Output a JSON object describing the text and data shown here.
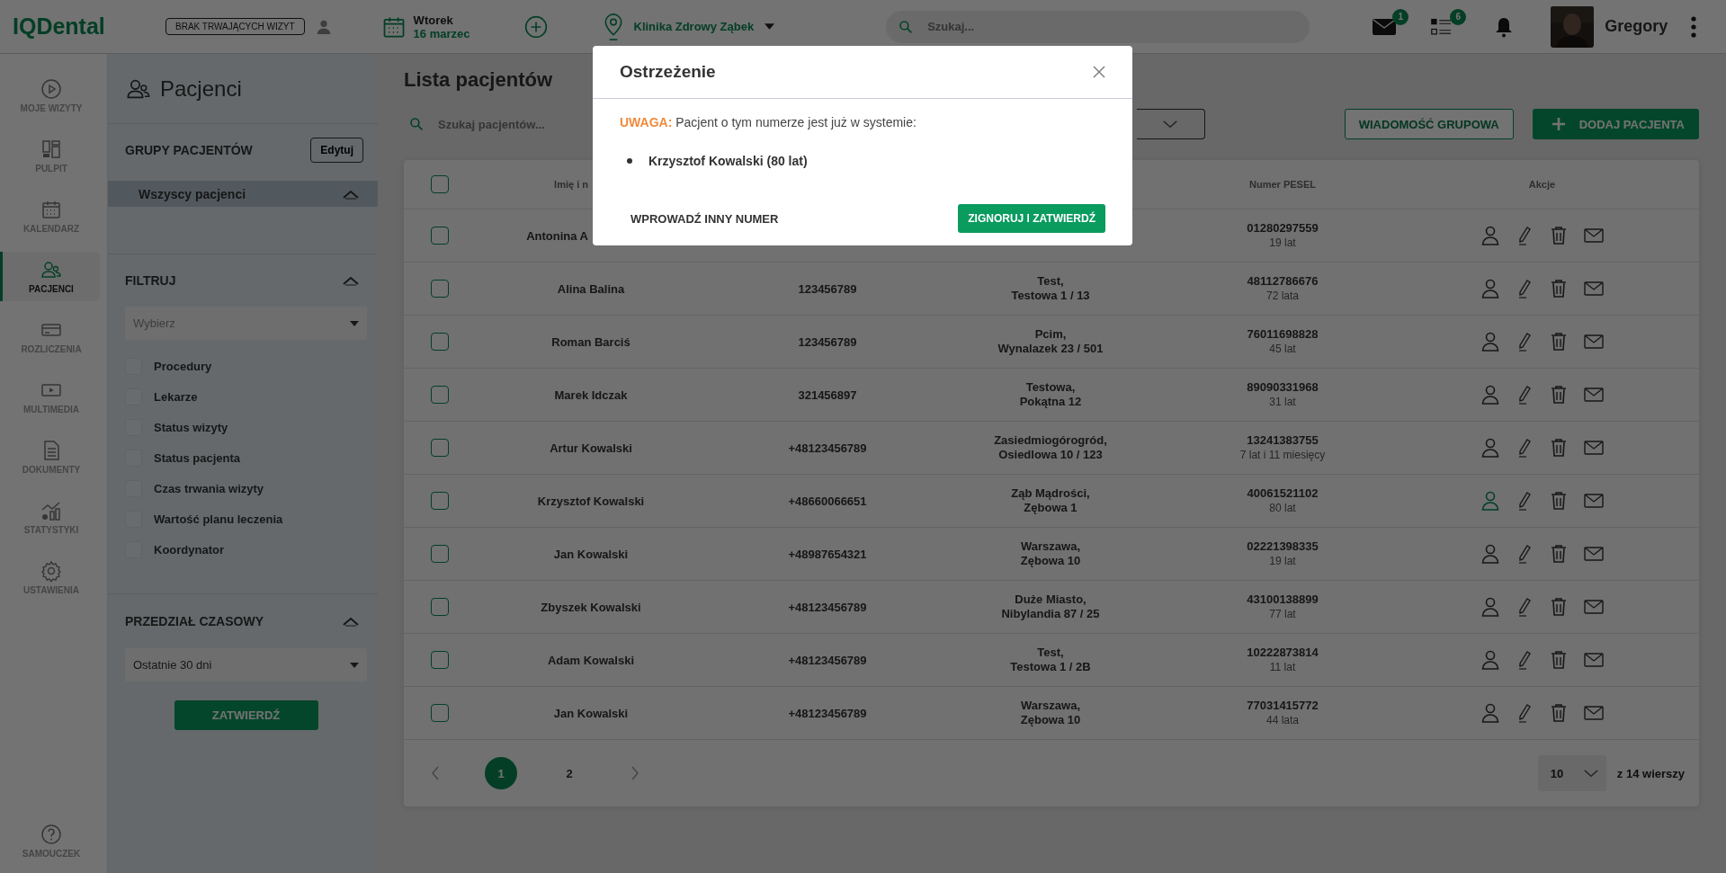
{
  "top_bar": {
    "logo": "IQDental",
    "visit_status": "BRAK TRWAJĄCYCH WIZYT",
    "day": "Wtorek",
    "date": "16 marzec",
    "clinic": "Klinika Zdrowy Ząbek",
    "search": {
      "placeholder": "Szukaj..."
    },
    "messages_count": "1",
    "tasks_count": "6",
    "user": "Gregory"
  },
  "nav": {
    "items": [
      {
        "label": "MOJE WIZYTY",
        "selected": false
      },
      {
        "label": "PULPIT",
        "selected": false
      },
      {
        "label": "KALENDARZ",
        "selected": false
      },
      {
        "label": "PACJENCI",
        "selected": true
      },
      {
        "label": "ROZLICZENIA",
        "selected": false
      },
      {
        "label": "MULTIMEDIA",
        "selected": false
      },
      {
        "label": "DOKUMENTY",
        "selected": false
      },
      {
        "label": "STATYSTYKI",
        "selected": false
      },
      {
        "label": "USTAWIENIA",
        "selected": false
      }
    ],
    "help": "SAMOUCZEK"
  },
  "sidebar": {
    "title": "Pacjenci",
    "groups": {
      "title": "GRUPY PACJENTÓW",
      "edit": "Edytuj",
      "expanded": true,
      "items": [
        {
          "label": "Wszyscy pacjenci",
          "selected": true
        }
      ]
    },
    "filter": {
      "title": "FILTRUJ",
      "expanded": true,
      "select": {
        "placeholder": "Wybierz"
      },
      "options": [
        {
          "label": "Procedury",
          "checked": false
        },
        {
          "label": "Lekarze",
          "checked": false
        },
        {
          "label": "Status wizyty",
          "checked": false
        },
        {
          "label": "Status pacjenta",
          "checked": false
        },
        {
          "label": "Czas trwania wizyty",
          "checked": false
        },
        {
          "label": "Wartość planu leczenia",
          "checked": false
        },
        {
          "label": "Koordynator",
          "checked": false
        }
      ]
    },
    "range": {
      "title": "PRZEDZIAŁ CZASOWY",
      "expanded": true,
      "value": "Ostatnie 30 dni",
      "submit": "ZATWIERDŹ"
    }
  },
  "main": {
    "title": "Lista pacjentów",
    "search": {
      "placeholder": "Szukaj pacjentów..."
    },
    "group_message": "WIADOMOŚĆ GRUPOWA",
    "add_patient": "DODAJ PACJENTA",
    "table": {
      "header": {
        "name": "Imię i n",
        "pesel": "Numer PESEL",
        "actions": "Akcje"
      },
      "all_checked": false,
      "rows": [
        {
          "name": "Antonina A",
          "pesel": "01280297559",
          "age": "19 lat",
          "checked": false,
          "highlighted": false
        },
        {
          "name": "Alina Balina",
          "phone": "123456789",
          "address": [
            "Test,",
            "Testowa 1 / 13"
          ],
          "pesel": "48112786676",
          "age": "72 lata",
          "checked": false,
          "highlighted": false
        },
        {
          "name": "Roman Barciś",
          "phone": "123456789",
          "address": [
            "Pcim,",
            "Wynalazek 23 / 501"
          ],
          "pesel": "76011698828",
          "age": "45 lat",
          "checked": false,
          "highlighted": false
        },
        {
          "name": "Marek Idczak",
          "phone": "321456897",
          "address": [
            "Testowa,",
            "Pokątna 12"
          ],
          "pesel": "89090331968",
          "age": "31 lat",
          "checked": false,
          "highlighted": false
        },
        {
          "name": "Artur Kowalski",
          "phone": "+48123456789",
          "address": [
            "Zasiedmiogórogród,",
            "Osiedlowa 10 / 123"
          ],
          "pesel": "13241383755",
          "age": "7 lat i 11 miesięcy",
          "checked": false,
          "highlighted": false
        },
        {
          "name": "Krzysztof Kowalski",
          "phone": "+48660066651",
          "address": [
            "Ząb Mądrości,",
            "Zębowa 1"
          ],
          "pesel": "40061521102",
          "age": "80 lat",
          "checked": false,
          "highlighted": true
        },
        {
          "name": "Jan Kowalski",
          "phone": "+48987654321",
          "address": [
            "Warszawa,",
            "Zębowa 10"
          ],
          "pesel": "02221398335",
          "age": "19 lat",
          "checked": false,
          "highlighted": false
        },
        {
          "name": "Zbyszek Kowalski",
          "phone": "+48123456789",
          "address": [
            "Duże Miasto,",
            "Nibylandia 87 / 25"
          ],
          "pesel": "43100138899",
          "age": "77 lat",
          "checked": false,
          "highlighted": false
        },
        {
          "name": "Adam Kowalski",
          "phone": "+48123456789",
          "address": [
            "Test,",
            "Testowa 1 / 2B"
          ],
          "pesel": "10222873814",
          "age": "11 lat",
          "checked": false,
          "highlighted": false
        },
        {
          "name": "Jan Kowalski",
          "phone": "+48123456789",
          "address": [
            "Warszawa,",
            "Zębowa 10"
          ],
          "pesel": "77031415772",
          "age": "44 lata",
          "checked": false,
          "highlighted": false
        }
      ]
    },
    "pagination": {
      "pages": [
        {
          "label": "1",
          "selected": true
        },
        {
          "label": "2",
          "selected": false
        }
      ],
      "page_size": "10",
      "total": "z 14 wierszy"
    }
  },
  "modal": {
    "title": "Ostrzeżenie",
    "warning_label": "UWAGA:",
    "message": "Pacjent o tym numerze jest już w systemie:",
    "patients": [
      "Krzysztof Kowalski (80 lat)"
    ],
    "secondary": "WPROWADŹ INNY NUMER",
    "primary": "ZIGNORUJ I ZATWIERDŹ"
  }
}
